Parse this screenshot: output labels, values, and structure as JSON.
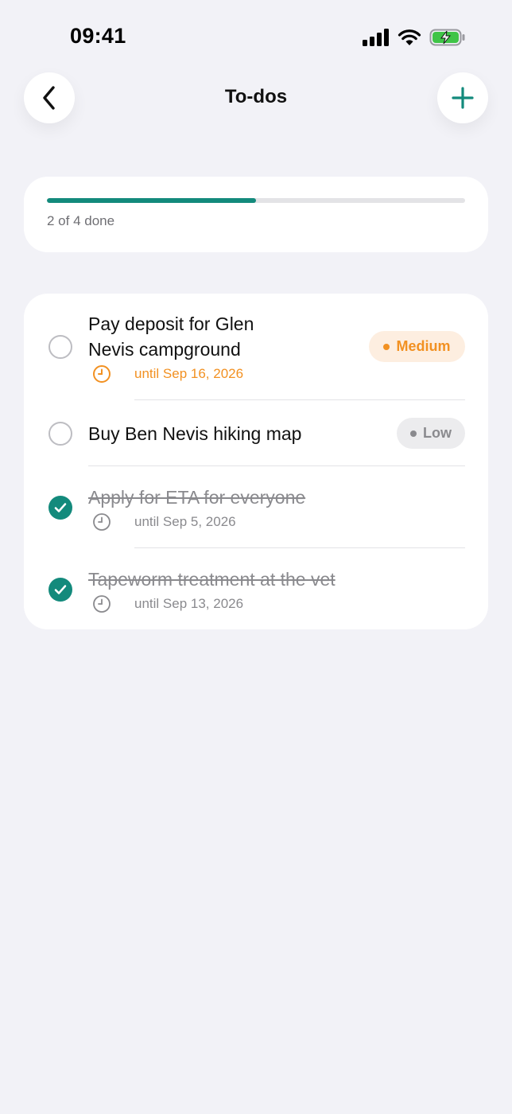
{
  "status_bar": {
    "time": "09:41"
  },
  "header": {
    "title": "To-dos"
  },
  "progress": {
    "label": "2 of 4 done",
    "fraction": 0.5
  },
  "tasks": [
    {
      "title_line1": "Pay deposit for Glen",
      "title_line2": "Nevis campground",
      "due": "until Sep 16, 2026",
      "priority": "Medium",
      "done": false
    },
    {
      "title": "Buy Ben Nevis hiking map",
      "priority": "Low",
      "done": false
    },
    {
      "title": "Apply for ETA for everyone",
      "due": "until Sep 5, 2026",
      "done": true
    },
    {
      "title": "Tapeworm treatment at the vet",
      "due": "until Sep 13, 2026",
      "done": true
    }
  ],
  "colors": {
    "accent": "#138a7c",
    "medium": "#f29122",
    "background": "#f2f2f7"
  }
}
